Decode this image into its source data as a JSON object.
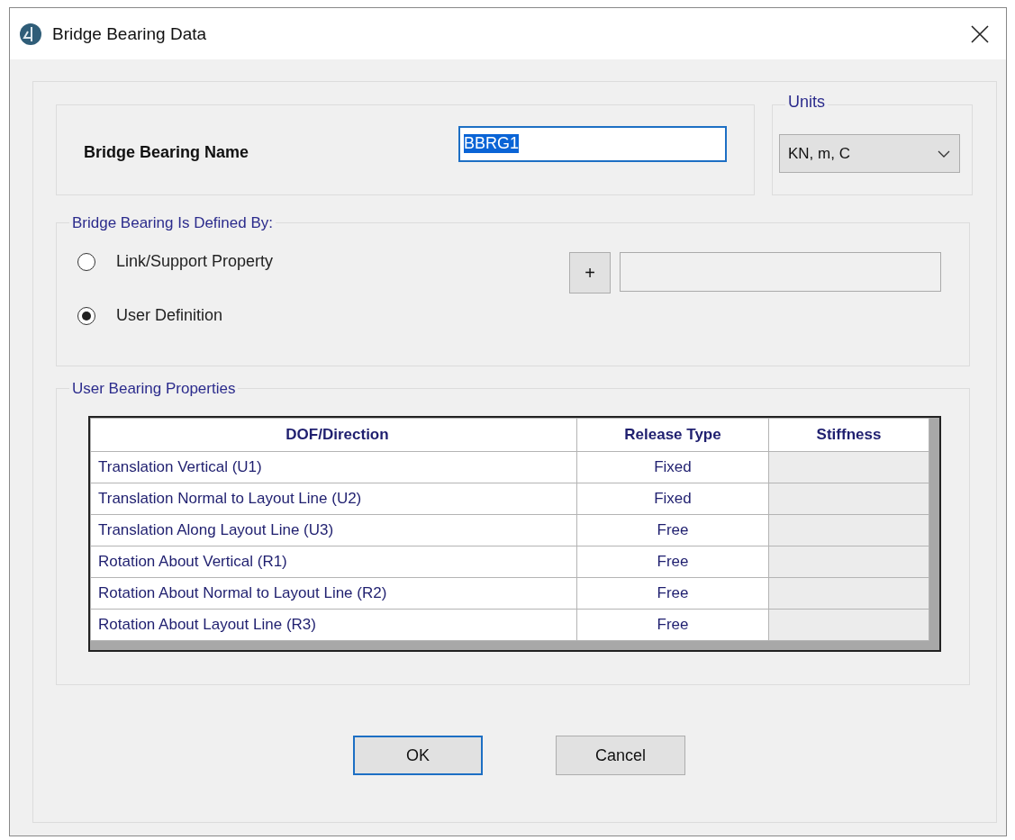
{
  "window": {
    "title": "Bridge Bearing Data"
  },
  "name_group": {
    "label": "Bridge Bearing Name",
    "value": "BBRG1",
    "selected": true
  },
  "units": {
    "legend": "Units",
    "value": "KN, m, C"
  },
  "defined_by": {
    "legend": "Bridge Bearing Is Defined By:",
    "options": [
      {
        "label": "Link/Support Property",
        "selected": false
      },
      {
        "label": "User Definition",
        "selected": true
      }
    ],
    "add_button": "+",
    "property_field": {
      "disabled": true
    }
  },
  "user_properties": {
    "legend": "User Bearing Properties",
    "columns": [
      "DOF/Direction",
      "Release Type",
      "Stiffness"
    ],
    "rows": [
      {
        "dof": "Translation Vertical (U1)",
        "release_type": "Fixed",
        "stiffness_disabled": true
      },
      {
        "dof": "Translation Normal to Layout Line (U2)",
        "release_type": "Fixed",
        "stiffness_disabled": true
      },
      {
        "dof": "Translation Along Layout Line (U3)",
        "release_type": "Free",
        "stiffness_disabled": true
      },
      {
        "dof": "Rotation About Vertical (R1)",
        "release_type": "Free",
        "stiffness_disabled": true
      },
      {
        "dof": "Rotation About Normal to Layout Line (R2)",
        "release_type": "Free",
        "stiffness_disabled": true
      },
      {
        "dof": "Rotation About Layout Line (R3)",
        "release_type": "Free",
        "stiffness_disabled": true
      }
    ]
  },
  "buttons": [
    {
      "label": "OK",
      "default": true
    },
    {
      "label": "Cancel",
      "default": false
    }
  ]
}
